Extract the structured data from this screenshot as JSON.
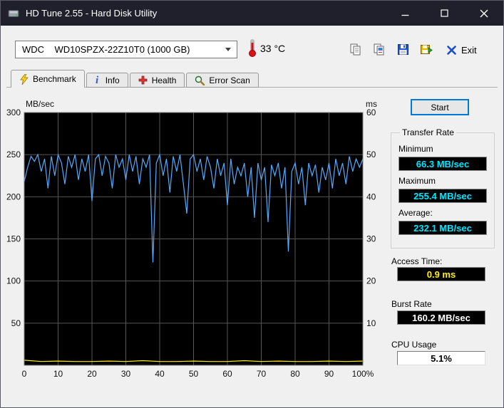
{
  "window": {
    "title": "HD Tune 2.55 - Hard Disk Utility"
  },
  "toolbar": {
    "drive_select": "WDC    WD10SPZX-22Z10T0 (1000 GB)",
    "temperature": "33 °C",
    "icons": [
      "thermometer-icon",
      "copy-text-icon",
      "copy-image-icon",
      "save-icon",
      "export-icon"
    ],
    "exit_label": "Exit"
  },
  "tabs": [
    {
      "label": "Benchmark",
      "icon": "lightning-icon",
      "active": true
    },
    {
      "label": "Info",
      "icon": "info-icon",
      "active": false
    },
    {
      "label": "Health",
      "icon": "health-cross-icon",
      "active": false
    },
    {
      "label": "Error Scan",
      "icon": "magnifier-icon",
      "active": false
    }
  ],
  "panel": {
    "start_label": "Start",
    "transfer_rate": {
      "legend": "Transfer Rate",
      "minimum_label": "Minimum",
      "minimum_value": "66.3 MB/sec",
      "maximum_label": "Maximum",
      "maximum_value": "255.4 MB/sec",
      "average_label": "Average:",
      "average_value": "232.1 MB/sec"
    },
    "access_time_label": "Access Time:",
    "access_time_value": "0.9 ms",
    "burst_rate_label": "Burst Rate",
    "burst_rate_value": "160.2 MB/sec",
    "cpu_usage_label": "CPU Usage",
    "cpu_usage_value": "5.1%"
  },
  "colors": {
    "titlebar": "#20202c",
    "chart_bg": "#000000",
    "grid": "#565656",
    "transfer_line": "#55aaff",
    "access_line": "#ffee00",
    "value_cyan": "#00e5ff",
    "value_yellow": "#ffee00",
    "value_white": "#ffffff"
  },
  "chart_data": {
    "type": "line",
    "title": "",
    "grid": true,
    "left_axis": {
      "label": "MB/sec",
      "min": 0,
      "max": 300,
      "tick_step": 50,
      "tick_labels": [
        "300",
        "250",
        "200",
        "150",
        "100",
        "50"
      ]
    },
    "right_axis": {
      "label": "ms",
      "min": 0,
      "max": 60,
      "tick_step": 10,
      "tick_labels": [
        "60",
        "50",
        "40",
        "30",
        "20",
        "10"
      ]
    },
    "x_axis": {
      "min": 0,
      "max": 100,
      "tick_labels": [
        "0",
        "10",
        "20",
        "30",
        "40",
        "50",
        "60",
        "70",
        "80",
        "90",
        "100%"
      ]
    },
    "series": [
      {
        "name": "transfer-rate-mbsec",
        "axis": "left",
        "color": "#55aaff",
        "values": [
          218,
          235,
          248,
          242,
          250,
          230,
          245,
          210,
          248,
          225,
          250,
          240,
          215,
          248,
          235,
          250,
          220,
          245,
          230,
          250,
          195,
          245,
          250,
          225,
          248,
          240,
          210,
          250,
          235,
          245,
          220,
          250,
          230,
          248,
          215,
          245,
          235,
          250,
          122,
          240,
          250,
          225,
          245,
          205,
          248,
          230,
          250,
          215,
          180,
          245,
          250,
          230,
          245,
          220,
          248,
          235,
          210,
          245,
          225,
          240,
          190,
          245,
          215,
          235,
          225,
          240,
          200,
          235,
          175,
          240,
          220,
          235,
          170,
          238,
          225,
          240,
          210,
          235,
          135,
          230,
          240,
          215,
          235,
          190,
          240,
          225,
          238,
          205,
          235,
          220,
          240,
          210,
          245,
          225,
          240,
          215,
          248,
          230,
          245,
          235,
          245
        ]
      },
      {
        "name": "access-time-ms",
        "axis": "right",
        "color": "#ffee00",
        "values": [
          1.2,
          0.9,
          1.0,
          0.9,
          0.9,
          1.0,
          0.9,
          1.1,
          0.9,
          0.9,
          1.0,
          0.9,
          0.9,
          1.1,
          0.9,
          1.0,
          0.9,
          0.9,
          1.0,
          0.9,
          1.0
        ]
      }
    ]
  }
}
